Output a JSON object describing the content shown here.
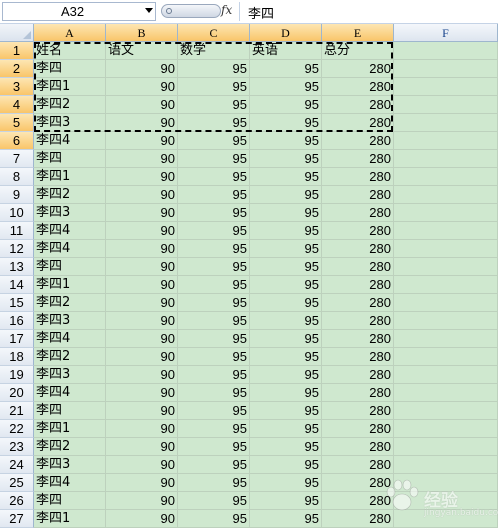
{
  "formula_bar": {
    "name_box": "A32",
    "fx_label": "fx",
    "formula_value": "李四"
  },
  "columns": [
    "A",
    "B",
    "C",
    "D",
    "E",
    "F"
  ],
  "selected_columns": [
    "A",
    "B",
    "C",
    "D",
    "E"
  ],
  "selected_rows": [
    1,
    2,
    3,
    4,
    5,
    6
  ],
  "rows": [
    {
      "n": "1",
      "cells": [
        "姓名",
        "语文",
        "数学",
        "英语",
        "总分"
      ]
    },
    {
      "n": "2",
      "cells": [
        "李四",
        "90",
        "95",
        "95",
        "280"
      ]
    },
    {
      "n": "3",
      "cells": [
        "李四1",
        "90",
        "95",
        "95",
        "280"
      ]
    },
    {
      "n": "4",
      "cells": [
        "李四2",
        "90",
        "95",
        "95",
        "280"
      ]
    },
    {
      "n": "5",
      "cells": [
        "李四3",
        "90",
        "95",
        "95",
        "280"
      ]
    },
    {
      "n": "6",
      "cells": [
        "李四4",
        "90",
        "95",
        "95",
        "280"
      ]
    },
    {
      "n": "7",
      "cells": [
        "李四",
        "90",
        "95",
        "95",
        "280"
      ]
    },
    {
      "n": "8",
      "cells": [
        "李四1",
        "90",
        "95",
        "95",
        "280"
      ]
    },
    {
      "n": "9",
      "cells": [
        "李四2",
        "90",
        "95",
        "95",
        "280"
      ]
    },
    {
      "n": "10",
      "cells": [
        "李四3",
        "90",
        "95",
        "95",
        "280"
      ]
    },
    {
      "n": "11",
      "cells": [
        "李四4",
        "90",
        "95",
        "95",
        "280"
      ]
    },
    {
      "n": "12",
      "cells": [
        "李四4",
        "90",
        "95",
        "95",
        "280"
      ]
    },
    {
      "n": "13",
      "cells": [
        "李四",
        "90",
        "95",
        "95",
        "280"
      ]
    },
    {
      "n": "14",
      "cells": [
        "李四1",
        "90",
        "95",
        "95",
        "280"
      ]
    },
    {
      "n": "15",
      "cells": [
        "李四2",
        "90",
        "95",
        "95",
        "280"
      ]
    },
    {
      "n": "16",
      "cells": [
        "李四3",
        "90",
        "95",
        "95",
        "280"
      ]
    },
    {
      "n": "17",
      "cells": [
        "李四4",
        "90",
        "95",
        "95",
        "280"
      ]
    },
    {
      "n": "18",
      "cells": [
        "李四2",
        "90",
        "95",
        "95",
        "280"
      ]
    },
    {
      "n": "19",
      "cells": [
        "李四3",
        "90",
        "95",
        "95",
        "280"
      ]
    },
    {
      "n": "20",
      "cells": [
        "李四4",
        "90",
        "95",
        "95",
        "280"
      ]
    },
    {
      "n": "21",
      "cells": [
        "李四",
        "90",
        "95",
        "95",
        "280"
      ]
    },
    {
      "n": "22",
      "cells": [
        "李四1",
        "90",
        "95",
        "95",
        "280"
      ]
    },
    {
      "n": "23",
      "cells": [
        "李四2",
        "90",
        "95",
        "95",
        "280"
      ]
    },
    {
      "n": "24",
      "cells": [
        "李四3",
        "90",
        "95",
        "95",
        "280"
      ]
    },
    {
      "n": "25",
      "cells": [
        "李四4",
        "90",
        "95",
        "95",
        "280"
      ]
    },
    {
      "n": "26",
      "cells": [
        "李四",
        "90",
        "95",
        "95",
        "280"
      ]
    },
    {
      "n": "27",
      "cells": [
        "李四1",
        "90",
        "95",
        "95",
        "280"
      ]
    }
  ],
  "watermark": {
    "text": "经验",
    "sub": "jingyan.baidu.com"
  },
  "colors": {
    "cell_fill": "#cfe8cf",
    "header_selected": "#f9c56a",
    "header_text": "#15428b"
  }
}
